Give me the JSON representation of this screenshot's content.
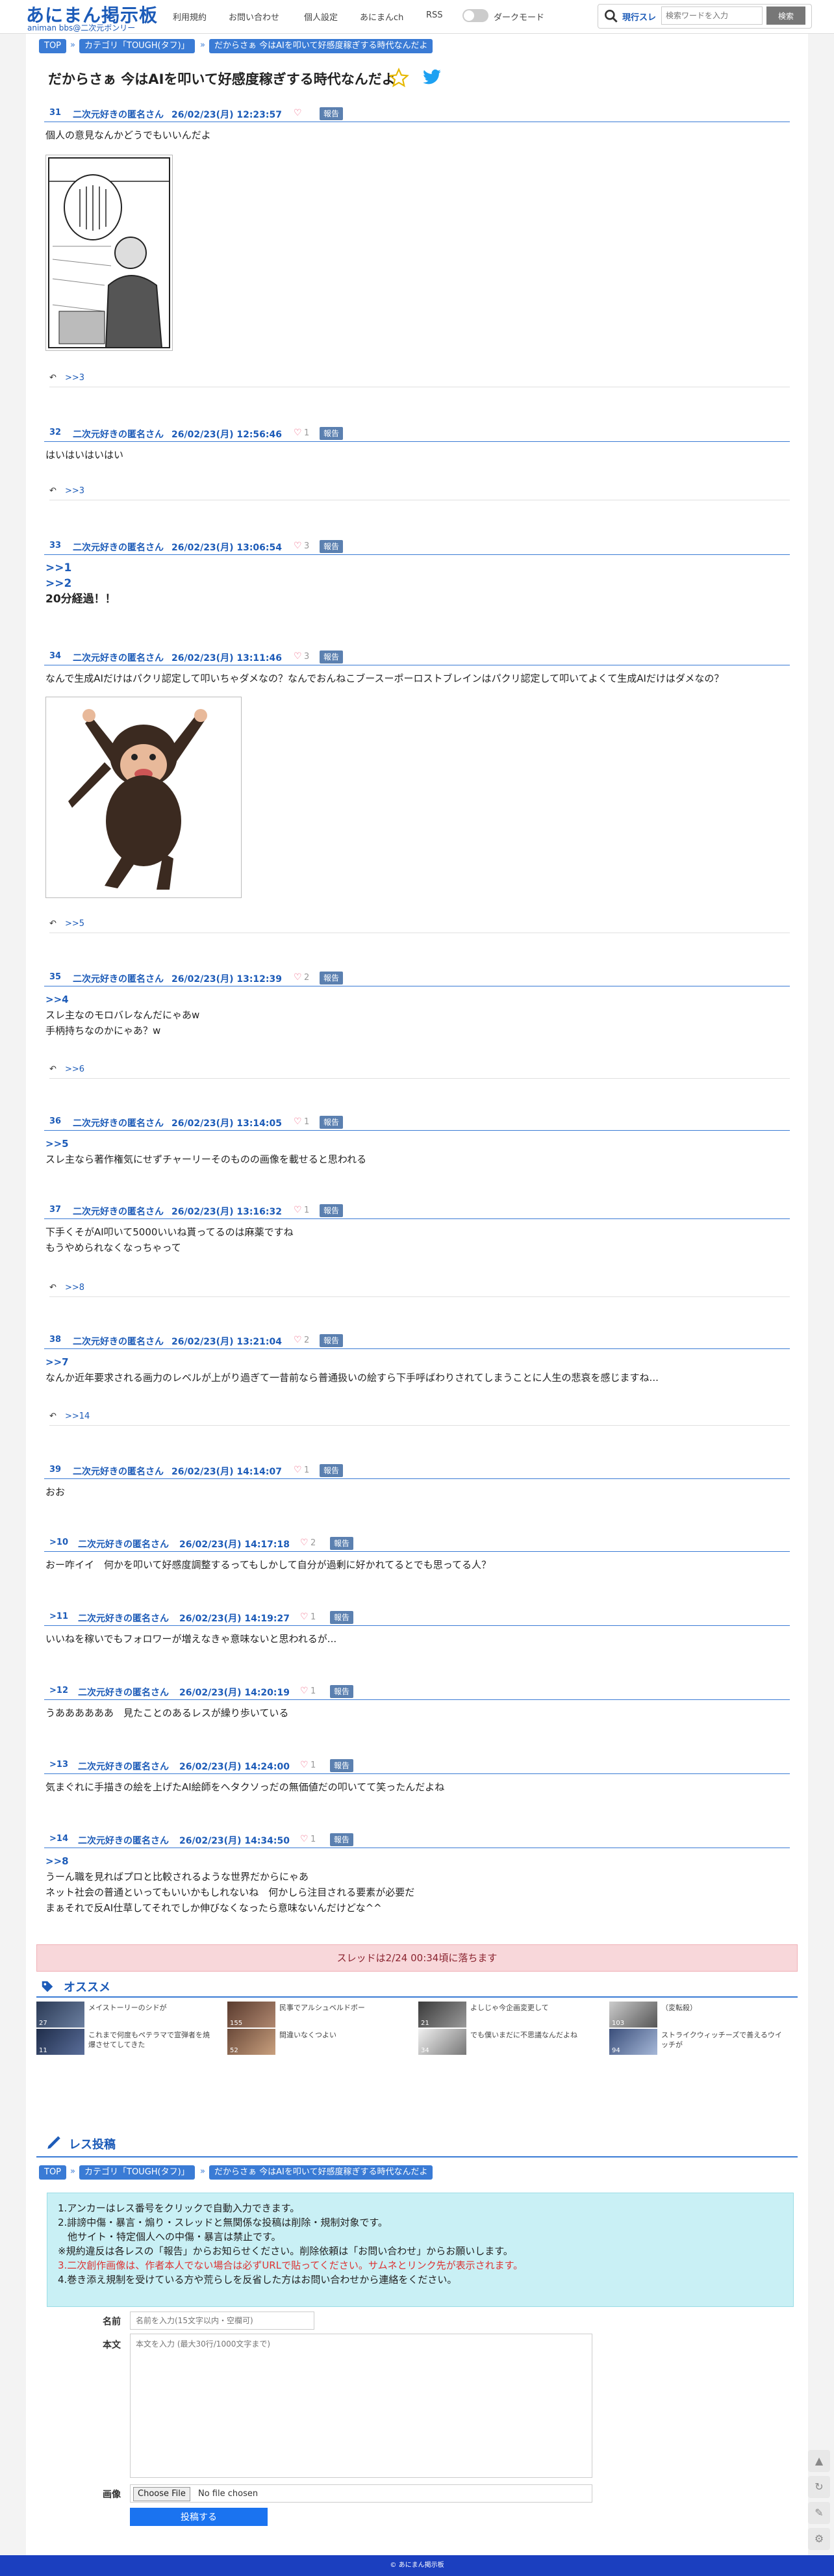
{
  "header": {
    "logo": "あにまん掲示板",
    "logo_sub": "animan bbs@二次元ボンリー",
    "nav": [
      "利用規約",
      "お問い合わせ",
      "個人設定",
      "あにまんch",
      "RSS"
    ],
    "dark_mode_label": "ダークモード",
    "search_label": "現行スレ",
    "search_placeholder": "検索ワードを入力",
    "search_button": "検索"
  },
  "breadcrumb": [
    "TOP",
    "カテゴリ「TOUGH(タフ)」",
    "だからさぁ 今はAIを叩いて好感度稼ぎする時代なんだよ"
  ],
  "thread_title": "だからさぁ 今はAIを叩いて好感度稼ぎする時代なんだよ",
  "report_label": "報告",
  "posts": [
    {
      "num": "31",
      "name": "二次元好きの匿名さん",
      "date": "26/02/23(月) 12:23:57",
      "likes": "",
      "lines": [
        "個人の意見なんかどうでもいいんだよ"
      ],
      "reply": ">>3"
    },
    {
      "num": "32",
      "name": "二次元好きの匿名さん",
      "date": "26/02/23(月) 12:56:46",
      "likes": "1",
      "lines": [
        "はいはいはいはい"
      ],
      "reply": ">>3"
    },
    {
      "num": "33",
      "name": "二次元好きの匿名さん",
      "date": "26/02/23(月) 13:06:54",
      "likes": "3",
      "anchors": [
        ">>1",
        ">>2"
      ],
      "lines": [
        "20分経過！！"
      ]
    },
    {
      "num": "34",
      "name": "二次元好きの匿名さん",
      "date": "26/02/23(月) 13:11:46",
      "likes": "3",
      "lines": [
        "なんで生成AIだけはパクリ認定して叩いちゃダメなの？なんでおんねこブースーポーロストブレインはパクリ認定して叩いてよくて生成AIだけはダメなの？"
      ],
      "reply": ">>5"
    },
    {
      "num": "35",
      "name": "二次元好きの匿名さん",
      "date": "26/02/23(月) 13:12:39",
      "likes": "2",
      "anchors": [
        ">>4"
      ],
      "lines": [
        "スレ主なのモロバレなんだにゃあw",
        "手柄持ちなのかにゃあ？w"
      ],
      "reply": ">>6"
    },
    {
      "num": "36",
      "name": "二次元好きの匿名さん",
      "date": "26/02/23(月) 13:14:05",
      "likes": "1",
      "anchors": [
        ">>5"
      ],
      "lines": [
        "スレ主なら著作権気にせずチャーリーそのものの画像を載せると思われる"
      ]
    },
    {
      "num": "37",
      "name": "二次元好きの匿名さん",
      "date": "26/02/23(月) 13:16:32",
      "likes": "1",
      "lines": [
        "下手くそがAI叩いて5000いいね貰ってるのは麻薬ですね",
        "もうやめられなくなっちゃって"
      ],
      "reply": ">>8"
    },
    {
      "num": "38",
      "name": "二次元好きの匿名さん",
      "date": "26/02/23(月) 13:21:04",
      "likes": "2",
      "anchors": [
        ">>7"
      ],
      "lines": [
        "なんか近年要求される画力のレベルが上がり過ぎて一昔前なら普通扱いの絵すら下手呼ばわりされてしまうことに人生の悲哀を感じますね..."
      ],
      "reply": ">>14"
    },
    {
      "num": "39",
      "name": "二次元好きの匿名さん",
      "date": "26/02/23(月) 14:14:07",
      "likes": "1",
      "lines": [
        "おお"
      ]
    },
    {
      "num": ">10",
      "name": "二次元好きの匿名さん",
      "date": "26/02/23(月) 14:17:18",
      "likes": "2",
      "lines": [
        "おー咋イイ　何かを叩いて好感度調整するってもしかして自分が過剰に好かれてるとでも思ってる人？"
      ]
    },
    {
      "num": ">11",
      "name": "二次元好きの匿名さん",
      "date": "26/02/23(月) 14:19:27",
      "likes": "1",
      "lines": [
        "いいねを稼いでもフォロワーが増えなきゃ意味ないと思われるが..."
      ]
    },
    {
      "num": ">12",
      "name": "二次元好きの匿名さん",
      "date": "26/02/23(月) 14:20:19",
      "likes": "1",
      "lines": [
        "うああああああ　見たことのあるレスが繰り歩いている"
      ]
    },
    {
      "num": ">13",
      "name": "二次元好きの匿名さん",
      "date": "26/02/23(月) 14:24:00",
      "likes": "1",
      "lines": [
        "気まぐれに手描きの絵を上げたAI絵師をヘタクソっだの無価値だの叩いてて笑ったんだよね"
      ]
    },
    {
      "num": ">14",
      "name": "二次元好きの匿名さん",
      "date": "26/02/23(月) 14:34:50",
      "likes": "1",
      "anchors": [
        ">>8"
      ],
      "lines": [
        "うーん職を見ればプロと比較されるような世界だからにゃあ",
        "ネット社会の普通といってもいいかもしれないね　何かしら注目される要素が必要だ",
        "まぁそれで反AI仕草してそれでしか伸びなくなったら意味ないんだけどな^^"
      ]
    }
  ],
  "drop_notice": "スレッドは2/24 00:34頃に落ちます",
  "recommend": {
    "title": "オススメ",
    "items": [
      {
        "text": "メイストーリーのシドが",
        "count": "27"
      },
      {
        "text": "民事でアルシュベルドボー",
        "count": "155"
      },
      {
        "text": "よしじゃ今企画変更して",
        "count": "21"
      },
      {
        "text": "（変転殺）",
        "count": "103"
      },
      {
        "text": "これまで何度もペテラマで宣弾者を焼爆させてしてきた",
        "count": "11"
      },
      {
        "text": "間違いなくつよい",
        "count": "52"
      },
      {
        "text": "でも僕いまだに不思議なんだよね",
        "count": "34"
      },
      {
        "text": "ストライクウィッチーズで善えるウイッチが",
        "count": "94"
      }
    ]
  },
  "reply_form": {
    "title": "レス投稿",
    "rules": [
      "1.アンカーはレス番号をクリックで自動入力できます。",
      "2.誹謗中傷・暴言・煽り・スレッドと無関係な投稿は削除・規制対象です。",
      "　他サイト・特定個人への中傷・暴言は禁止です。",
      "※規約違反は各レスの「報告」からお知らせください。削除依頼は「お問い合わせ」からお願いします。",
      "3.二次創作画像は、作者本人でない場合は必ずURLで貼ってください。サムネとリンク先が表示されます。",
      "4.巻き添え規制を受けている方や荒らしを反省した方はお問い合わせから連絡をください。"
    ],
    "name_label": "名前",
    "name_placeholder": "名前を入力(15文字以内・空欄可)",
    "body_label": "本文",
    "body_placeholder": "本文を入力 (最大30行/1000文字まで)",
    "image_label": "画像",
    "file_button": "Choose File",
    "file_status": "No file chosen",
    "submit": "投稿する"
  },
  "footer": "© あにまん掲示板",
  "colors": {
    "accent": "#1c5bb8",
    "link": "#3a7bd5",
    "alert_bg": "#f8d7da",
    "rules_bg": "#c9f0f5",
    "footer_bg": "#1b3fbf"
  }
}
